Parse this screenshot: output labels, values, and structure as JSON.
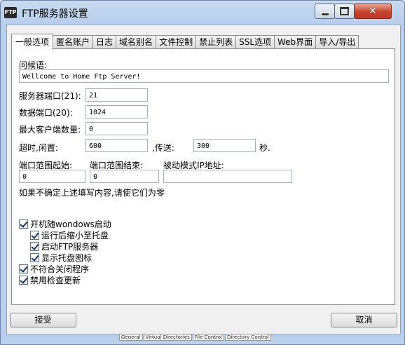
{
  "window": {
    "icon_text": "FTP",
    "title": "FTP服务器设置"
  },
  "tabs": [
    {
      "label": "一般选项",
      "active": true
    },
    {
      "label": "匿名账户"
    },
    {
      "label": "日志"
    },
    {
      "label": "域名别名"
    },
    {
      "label": "文件控制"
    },
    {
      "label": "禁止列表"
    },
    {
      "label": "SSL选项"
    },
    {
      "label": "Web界面"
    },
    {
      "label": "导入/导出"
    }
  ],
  "general": {
    "greeting_label": "问候语:",
    "greeting_value": "Wellcome to Home Ftp Server!",
    "server_port_label": "服务器端口(21):",
    "server_port_value": "21",
    "data_port_label": "数据端口(20):",
    "data_port_value": "1024",
    "max_clients_label": "最大客户端数量:",
    "max_clients_value": "0",
    "timeout_label": "超时,闲置:",
    "idle_value": "600",
    "transfer_label": ",传送:",
    "transfer_value": "300",
    "seconds_label": "秒.",
    "port_range_start_label": "端口范围起始:",
    "port_range_start_value": "0",
    "port_range_end_label": "端口范围结束:",
    "port_range_end_value": "0",
    "passive_ip_label": "被动模式IP地址:",
    "passive_ip_value": "",
    "hint_text": "如果不确定上述填写内容,请使它们为零"
  },
  "checkboxes": {
    "start_with_windows": {
      "label": "开机随wondows启动",
      "checked": true
    },
    "minimize_to_tray": {
      "label": "运行后缩小至托盘",
      "checked": true
    },
    "start_ftp_server": {
      "label": "启动FTP服务器",
      "checked": true
    },
    "show_tray_icon": {
      "label": "显示托盘图标",
      "checked": true
    },
    "no_close_program": {
      "label": "不符合关闭程序",
      "checked": true
    },
    "disable_update_check": {
      "label": "禁用检查更新",
      "checked": true
    }
  },
  "buttons": {
    "accept": "接受",
    "cancel": "取消"
  },
  "background_tabs": [
    "General",
    "Virtual Directories",
    "File Control",
    "Directory Control"
  ]
}
